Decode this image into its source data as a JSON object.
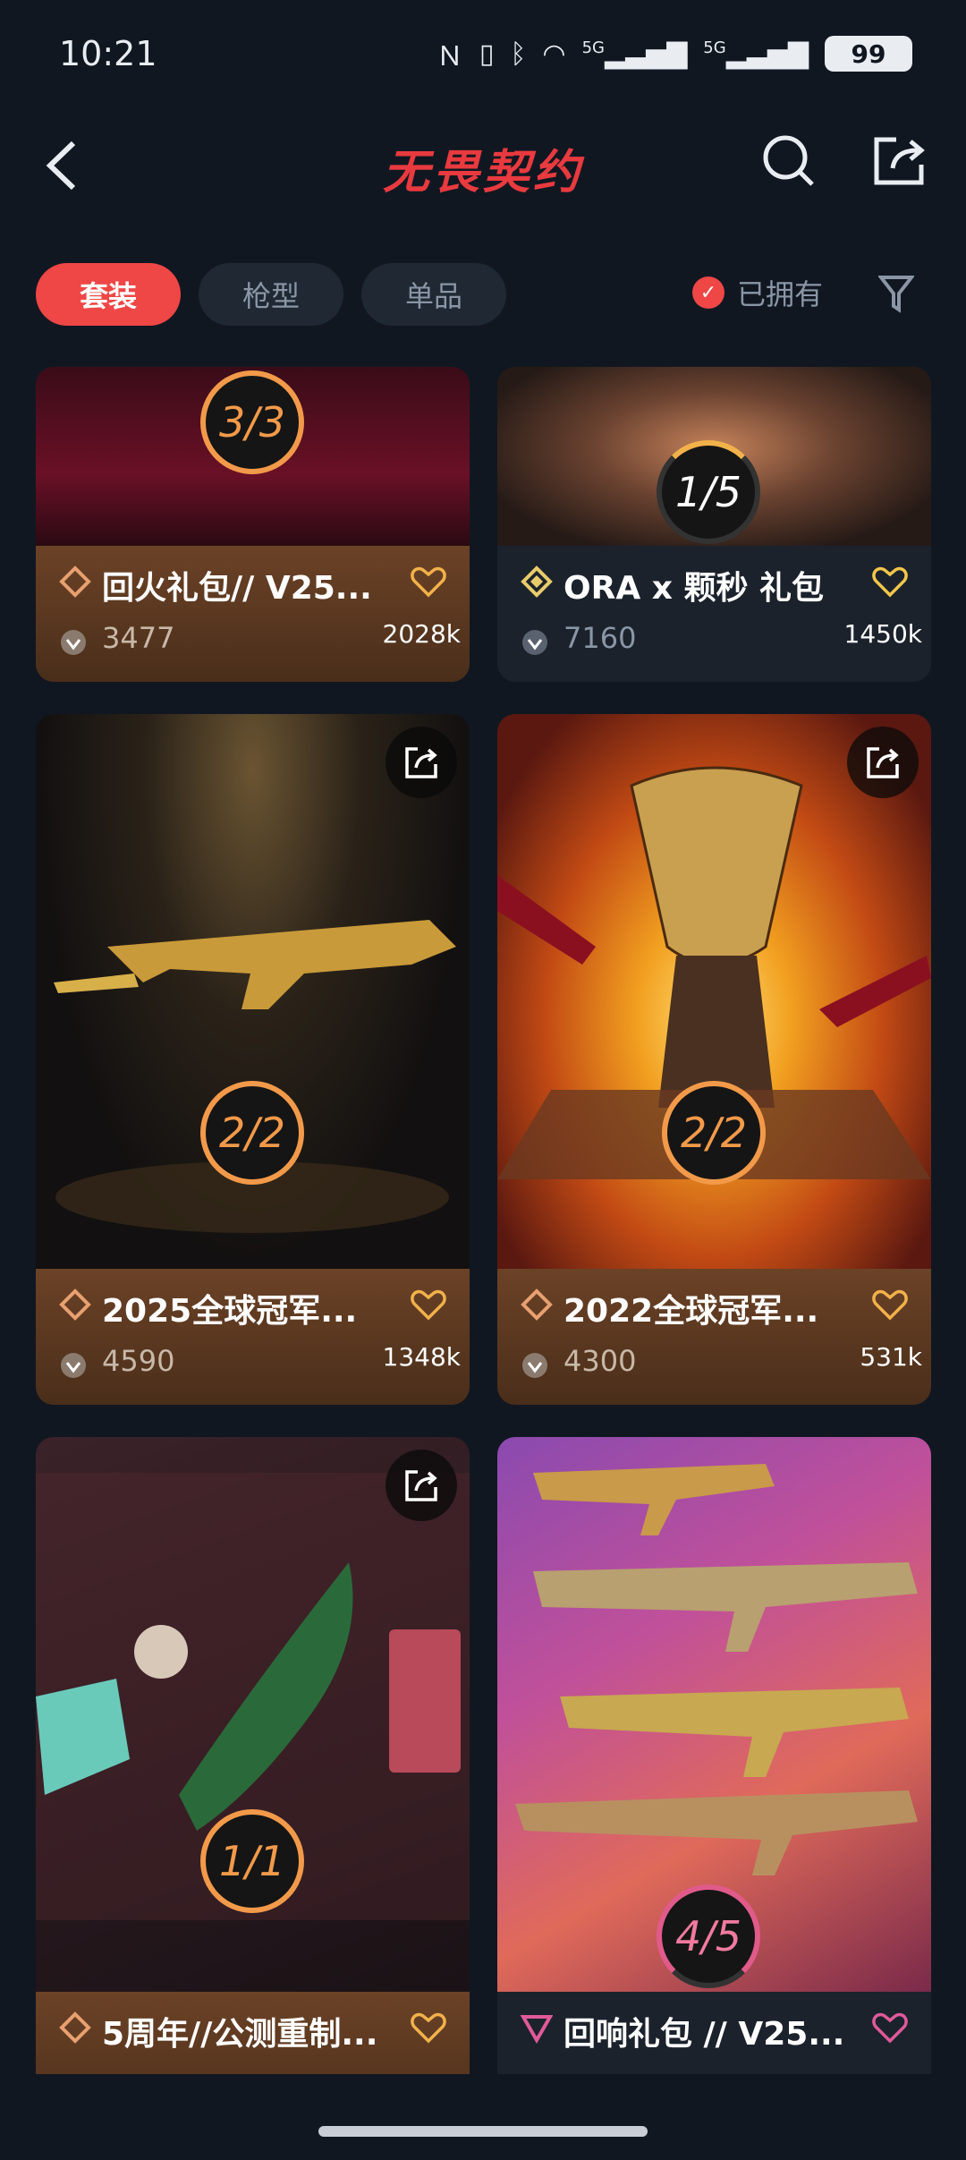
{
  "status": {
    "time": "10:21",
    "battery": "99",
    "signal1": "5G",
    "signal2": "5G"
  },
  "header": {
    "title": "无畏契约"
  },
  "filters": {
    "tabs": [
      {
        "label": "套装"
      },
      {
        "label": "枪型"
      },
      {
        "label": "单品"
      }
    ],
    "owned_label": "已拥有"
  },
  "cards": [
    {
      "name": "回火礼包// V25...",
      "progress": "3/3",
      "likes": "3477",
      "views": "2028k"
    },
    {
      "name": "ORA x 颗秒 礼包",
      "progress": "1/5",
      "likes": "7160",
      "views": "1450k"
    },
    {
      "name": "2025全球冠军...",
      "progress": "2/2",
      "likes": "4590",
      "views": "1348k"
    },
    {
      "name": "2022全球冠军...",
      "progress": "2/2",
      "likes": "4300",
      "views": "531k"
    },
    {
      "name": "5周年//公测重制...",
      "progress": "1/1",
      "likes": "",
      "views": ""
    },
    {
      "name": "回响礼包 // V25...",
      "progress": "4/5",
      "likes": "",
      "views": ""
    }
  ]
}
